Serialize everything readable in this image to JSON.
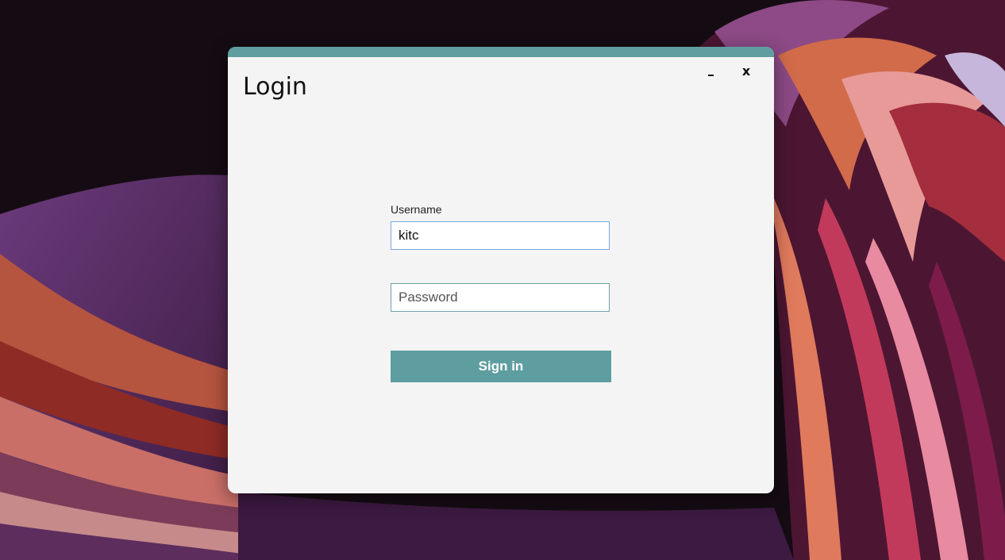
{
  "window": {
    "title": "Login",
    "minimize_label": "-",
    "close_label": "x",
    "accent_color": "#5f9ea0"
  },
  "form": {
    "username_label": "Username",
    "username_value": "kitc",
    "password_placeholder": "Password",
    "password_value": "",
    "signin_label": "Sign in"
  },
  "icons": {
    "minimize": "minimize-icon",
    "close": "close-icon"
  }
}
